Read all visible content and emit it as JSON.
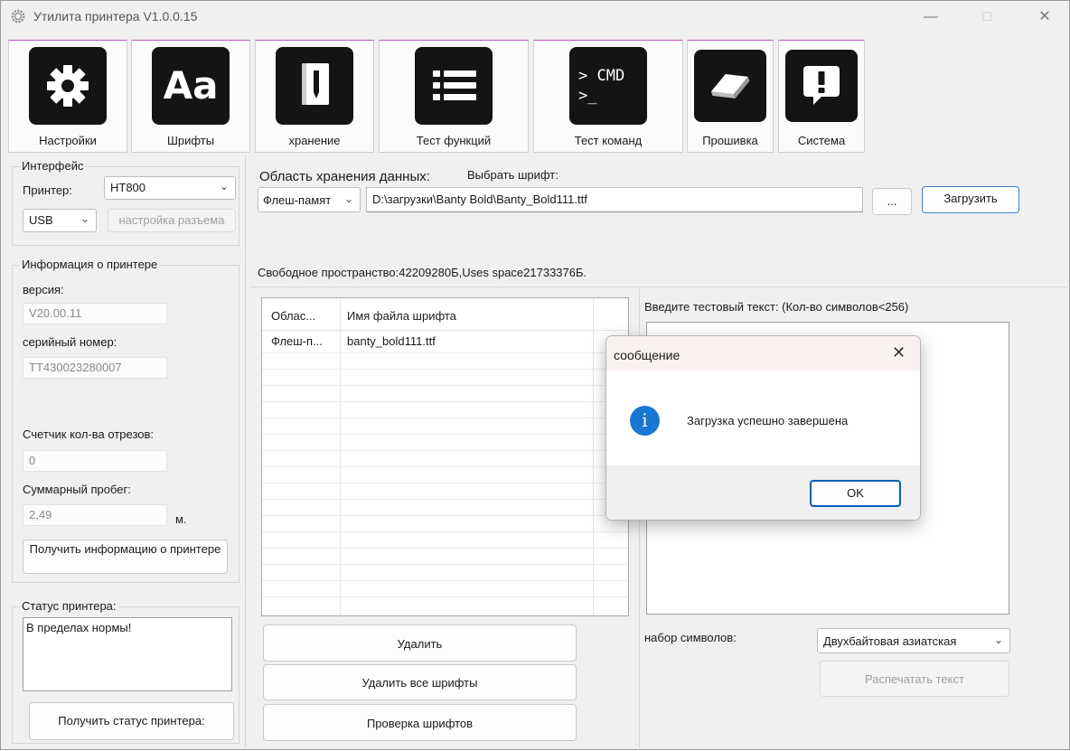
{
  "window": {
    "title": "Утилита принтера  V1.0.0.15",
    "minimize_glyph": "—",
    "maximize_glyph": "☐",
    "close_glyph": "✕"
  },
  "toolbar": [
    {
      "label": "Настройки",
      "icon": "settings-gear-icon"
    },
    {
      "label": "Шрифты",
      "icon": "font-icon",
      "icon_text": "Aa"
    },
    {
      "label": "хранение",
      "icon": "notebook-icon"
    },
    {
      "label": "Тест функций",
      "icon": "list-icon"
    },
    {
      "label": "Тест команд",
      "icon": "terminal-icon",
      "icon_text_1": "> CMD",
      "icon_text_2": ">_"
    },
    {
      "label": "Прошивка",
      "icon": "chip-icon"
    },
    {
      "label": "Система",
      "icon": "alert-icon"
    }
  ],
  "interface": {
    "group_title": "Интерфейс",
    "printer_label": "Принтер:",
    "printer_value": "HT800",
    "port_value": "USB",
    "port_settings_label": "настройка разъема"
  },
  "printer_info": {
    "group_title": "Информация о принтере",
    "version_label": "версия:",
    "version_value": "V20.00.11",
    "serial_label": "серийный номер:",
    "serial_value": "TT430023280007",
    "cut_counter_label": "Счетчик кол-ва отрезов:",
    "cut_counter_value": "0",
    "mileage_label": "Суммарный пробег:",
    "mileage_value": "2,49",
    "mileage_unit": "м.",
    "get_info_button": "Получить информацию о принтере"
  },
  "printer_status": {
    "group_title": "Статус принтера:",
    "status_text": "В пределах нормы!",
    "get_status_button": "Получить статус принтера:"
  },
  "storage": {
    "area_label": "Область хранения данных:",
    "choose_font_label": "Выбрать шрифт:",
    "area_value": "Флеш-памят",
    "font_path": "D:\\загрузки\\Banty Bold\\Banty_Bold111.ttf",
    "browse_label": "...",
    "upload_button": "Загрузить",
    "free_space": "Свободное пространство:42209280Б,Uses space21733376Б."
  },
  "font_table": {
    "columns": [
      "Облас...",
      "Имя файла шрифта"
    ],
    "rows": [
      [
        "Флеш-п...",
        "banty_bold111.ttf"
      ]
    ]
  },
  "actions": {
    "delete": "Удалить",
    "delete_all": "Удалить все шрифты",
    "check_fonts": "Проверка шрифтов"
  },
  "test_text": {
    "label": "Введите тестовый текст: (Кол-во символов<256)",
    "charset_label": "набор символов:",
    "charset_value": "Двухбайтовая азиатская",
    "print_button": "Распечатать текст"
  },
  "dialog": {
    "title": "сообщение",
    "message": "Загрузка успешно завершена",
    "ok": "OK",
    "close_glyph": "✕",
    "info_glyph": "i",
    "accent": "#1976d2"
  }
}
